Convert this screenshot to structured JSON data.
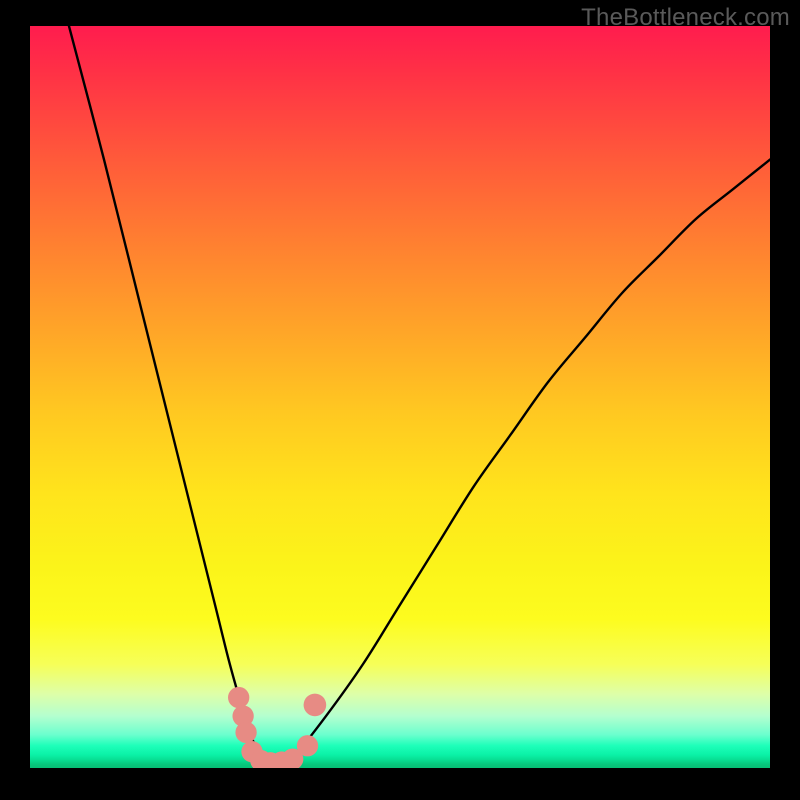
{
  "watermark": "TheBottleneck.com",
  "chart_data": {
    "type": "line",
    "title": "",
    "xlabel": "",
    "ylabel": "",
    "xlim": [
      0,
      100
    ],
    "ylim": [
      0,
      100
    ],
    "series": [
      {
        "name": "bottleneck-curve",
        "x": [
          5,
          10,
          15,
          20,
          25,
          27,
          29,
          30,
          31,
          32,
          34,
          36,
          40,
          45,
          50,
          55,
          60,
          65,
          70,
          75,
          80,
          85,
          90,
          95,
          100
        ],
        "values": [
          101,
          82,
          62,
          42,
          22,
          14,
          7,
          4,
          2,
          1,
          1,
          2,
          7,
          14,
          22,
          30,
          38,
          45,
          52,
          58,
          64,
          69,
          74,
          78,
          82
        ]
      }
    ],
    "markers": [
      {
        "name": "dot",
        "x": 28.2,
        "y": 9.5,
        "r": 1.6
      },
      {
        "name": "dot",
        "x": 28.8,
        "y": 7.0,
        "r": 1.6
      },
      {
        "name": "dot",
        "x": 29.2,
        "y": 4.8,
        "r": 1.6
      },
      {
        "name": "dot",
        "x": 30.0,
        "y": 2.2,
        "r": 1.6
      },
      {
        "name": "dot",
        "x": 31.2,
        "y": 1.0,
        "r": 1.6
      },
      {
        "name": "dot",
        "x": 32.5,
        "y": 0.7,
        "r": 1.6
      },
      {
        "name": "dot",
        "x": 34.0,
        "y": 0.8,
        "r": 1.6
      },
      {
        "name": "dot",
        "x": 35.5,
        "y": 1.2,
        "r": 1.6
      },
      {
        "name": "dot",
        "x": 37.5,
        "y": 3.0,
        "r": 1.6
      },
      {
        "name": "dot",
        "x": 38.5,
        "y": 8.5,
        "r": 1.7
      }
    ],
    "marker_color": "#e78b84",
    "curve_color": "#000000",
    "grid": false
  }
}
